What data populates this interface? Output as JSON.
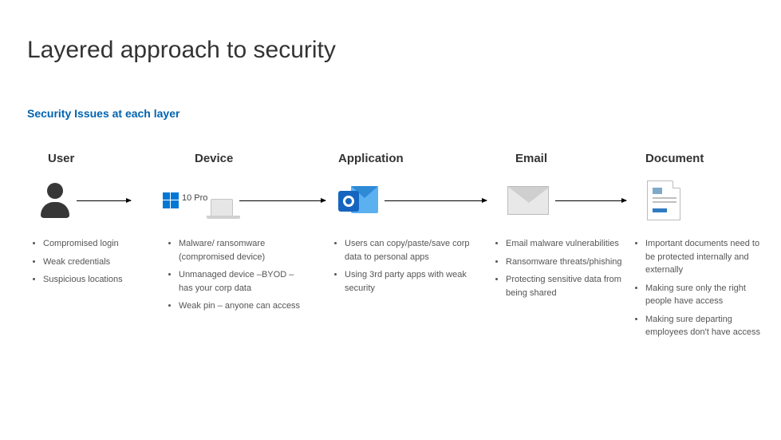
{
  "title": "Layered approach to security",
  "subtitle": "Security Issues at each layer",
  "columns": {
    "user": {
      "heading": "User",
      "issues": [
        "Compromised login",
        "Weak credentials",
        "Suspicious locations"
      ]
    },
    "device": {
      "heading": "Device",
      "pro_label": "10 Pro",
      "issues": [
        "Malware/ ransomware (compromised device)",
        "Unmanaged device –BYOD – has your corp data",
        "Weak pin – anyone can access"
      ]
    },
    "application": {
      "heading": "Application",
      "issues": [
        "Users can copy/paste/save corp data to personal apps",
        "Using 3rd party apps with weak security"
      ]
    },
    "email": {
      "heading": "Email",
      "issues": [
        "Email malware vulnerabilities",
        "Ransomware threats/phishing",
        "Protecting sensitive data from being shared"
      ]
    },
    "document": {
      "heading": "Document",
      "issues": [
        "Important documents need to be protected internally and externally",
        "Making sure only the right people have access",
        "Making sure departing employees don't have access"
      ]
    }
  }
}
